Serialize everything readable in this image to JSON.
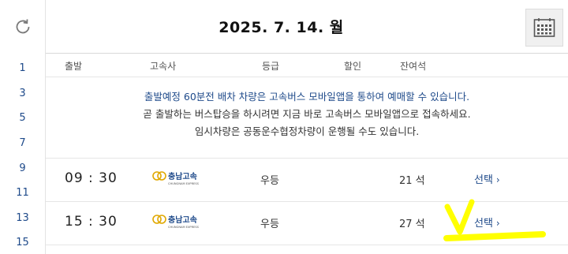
{
  "header": {
    "title": "2025. 7. 14. 월"
  },
  "hour_rail": {
    "hours": [
      "1",
      "3",
      "5",
      "7",
      "9",
      "11",
      "13",
      "15"
    ]
  },
  "columns": {
    "departure": "출발",
    "bus_company": "고속사",
    "grade": "등급",
    "discount": "할인",
    "remaining_seats": "잔여석"
  },
  "notice": {
    "line1": "출발예정 60분전 배차 차량은 고속버스 모바일앱을 통하여 예매할 수 있습니다.",
    "line2": "곧 출발하는 버스탑승을 하시려면 지금 바로 고속버스 모바일앱으로 접속하세요.",
    "line3": "임시차량은 공동운수협정차량이 운행될 수도 있습니다."
  },
  "schedules": [
    {
      "time": "09 : 30",
      "company": "충남고속",
      "company_sub": "CHUNGNAM EXPRESS",
      "grade": "우등",
      "seats": "21 석",
      "action": "선택"
    },
    {
      "time": "15 : 30",
      "company": "충남고속",
      "company_sub": "CHUNGNAM EXPRESS",
      "grade": "우등",
      "seats": "27 석",
      "action": "선택"
    }
  ],
  "colors": {
    "accent_blue": "#1e4a8a",
    "logo_gold": "#e0a800",
    "highlight": "#ffff00"
  }
}
